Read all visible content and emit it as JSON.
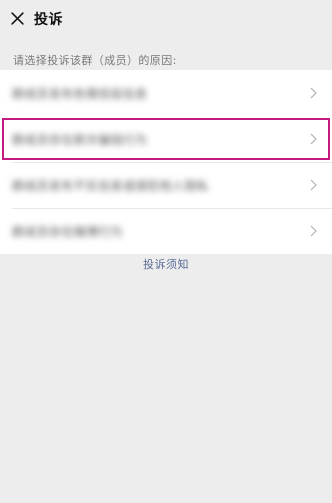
{
  "header": {
    "title": "投诉",
    "close_icon": "close-icon"
  },
  "prompt": "请选择投诉该群（成员）的原因:",
  "reasons": [
    {
      "label": "群成员发布色情低俗信息",
      "highlighted": false
    },
    {
      "label": "群成员存在欺诈骗钱行为",
      "highlighted": true
    },
    {
      "label": "群成员发布不实信息或侵犯他人隐私",
      "highlighted": false
    },
    {
      "label": "群成员存在赌博行为",
      "highlighted": false
    }
  ],
  "notice_link": "投诉须知",
  "colors": {
    "highlight": "#c21a7e",
    "link": "#576b95",
    "background": "#ededed"
  }
}
